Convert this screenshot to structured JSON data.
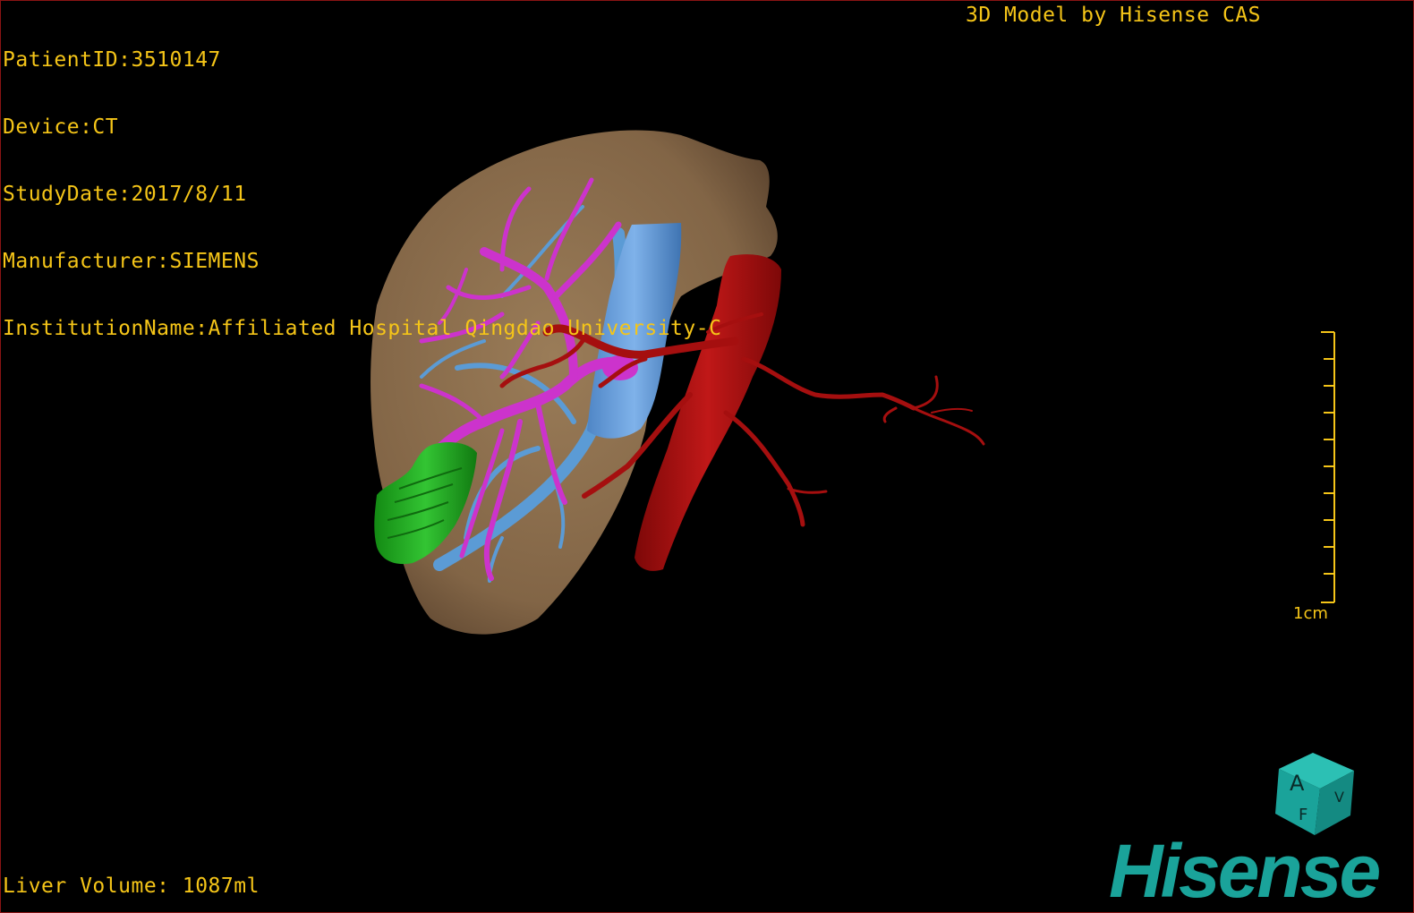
{
  "study_info": {
    "patient_id": "PatientID:3510147",
    "device": "Device:CT",
    "study_date": "StudyDate:2017/8/11",
    "manufacturer": "Manufacturer:SIEMENS",
    "institution": "InstitutionName:Affiliated Hospital Qingdao University-C"
  },
  "credit": "3D Model by Hisense CAS",
  "liver_volume": "Liver Volume: 1087ml",
  "scale_bar": {
    "label": "1cm"
  },
  "orientation_cube": {
    "labels": [
      "A",
      "F",
      "V"
    ],
    "color": "#1aa39a"
  },
  "logo": {
    "text": "Hisense",
    "color": "#1aa39a"
  },
  "colors": {
    "text": "#f5c518",
    "liver": "#8b6e4e",
    "portal_vein": "#cc33cc",
    "hepatic_vein": "#5b9bd5",
    "artery": "#a50f0f",
    "tumor": "#22a022"
  }
}
